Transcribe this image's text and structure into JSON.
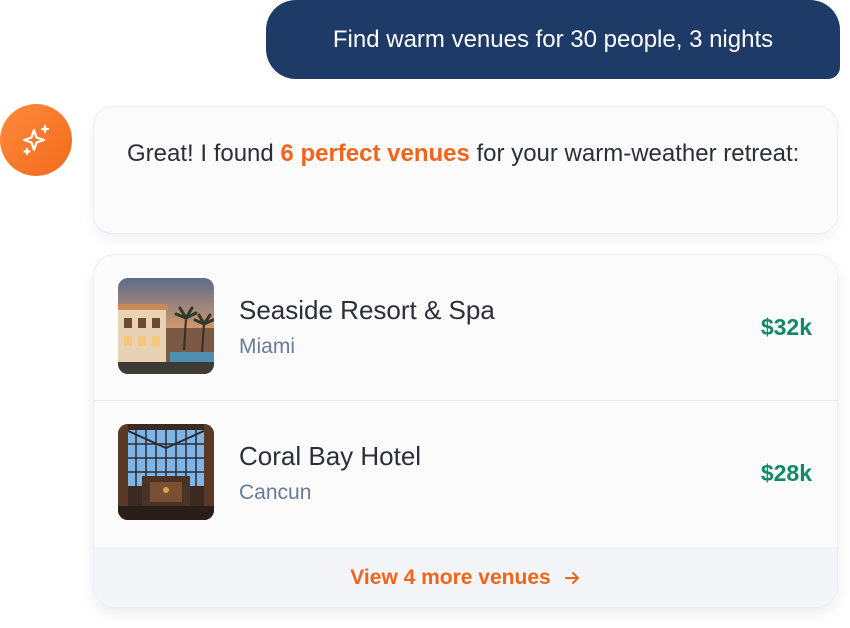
{
  "user_message": "Find warm venues for 30 people, 3 nights",
  "assistant": {
    "avatar_icon": "sparkles-icon",
    "message_prefix": "Great! I found ",
    "message_highlight": "6 perfect venues",
    "message_suffix": " for your warm-weather retreat:"
  },
  "venues": [
    {
      "name": "Seaside Resort & Spa",
      "city": "Miami",
      "price": "$32k"
    },
    {
      "name": "Coral Bay Hotel",
      "city": "Cancun",
      "price": "$28k"
    }
  ],
  "more_link": {
    "label": "View 4 more venues",
    "icon": "arrow-right-icon"
  },
  "colors": {
    "user_bubble": "#1e3a66",
    "accent": "#f2641c",
    "price": "#118a63"
  }
}
